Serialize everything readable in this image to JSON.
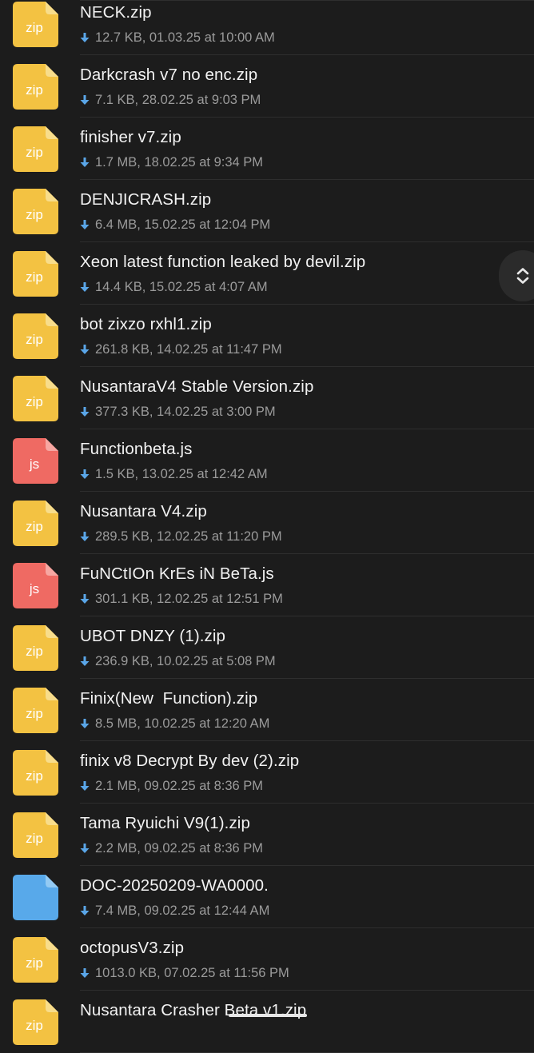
{
  "colors": {
    "background": "#1c1c1c",
    "zip_icon": "#f3c242",
    "zip_fold": "#f8dd8b",
    "js_icon": "#ef6a63",
    "js_fold": "#f7a7a2",
    "doc_icon": "#58a9ea",
    "doc_fold": "#93caf3",
    "name_text": "#f2f2f2",
    "meta_text": "#9b9b9b",
    "download_arrow": "#5aa6e8"
  },
  "files": [
    {
      "name": "NECK.zip",
      "meta": "12.7 KB, 01.03.25 at 10:00 AM",
      "type": "zip",
      "icon_label": "zip"
    },
    {
      "name": "Darkcrash v7 no enc.zip",
      "meta": "7.1 KB, 28.02.25 at 9:03 PM",
      "type": "zip",
      "icon_label": "zip"
    },
    {
      "name": "finisher v7.zip",
      "meta": "1.7 MB, 18.02.25 at 9:34 PM",
      "type": "zip",
      "icon_label": "zip"
    },
    {
      "name": "DENJICRASH.zip",
      "meta": "6.4 MB, 15.02.25 at 12:04 PM",
      "type": "zip",
      "icon_label": "zip"
    },
    {
      "name": "Xeon latest function leaked by devil.zip",
      "meta": "14.4 KB, 15.02.25 at 4:07 AM",
      "type": "zip",
      "icon_label": "zip"
    },
    {
      "name": "bot zixzo rxhl1.zip",
      "meta": "261.8 KB, 14.02.25 at 11:47 PM",
      "type": "zip",
      "icon_label": "zip"
    },
    {
      "name": "NusantaraV4 Stable Version.zip",
      "meta": "377.3 KB, 14.02.25 at 3:00 PM",
      "type": "zip",
      "icon_label": "zip"
    },
    {
      "name": "Functionbeta.js",
      "meta": "1.5 KB, 13.02.25 at 12:42 AM",
      "type": "js",
      "icon_label": "js"
    },
    {
      "name": "Nusantara V4.zip",
      "meta": "289.5 KB, 12.02.25 at 11:20 PM",
      "type": "zip",
      "icon_label": "zip"
    },
    {
      "name": "FuNCtIOn KrEs iN BeTa.js",
      "meta": "301.1 KB, 12.02.25 at 12:51 PM",
      "type": "js",
      "icon_label": "js"
    },
    {
      "name": "UBOT DNZY (1).zip",
      "meta": "236.9 KB, 10.02.25 at 5:08 PM",
      "type": "zip",
      "icon_label": "zip"
    },
    {
      "name": "Finix(New  Function).zip",
      "meta": "8.5 MB, 10.02.25 at 12:20 AM",
      "type": "zip",
      "icon_label": "zip"
    },
    {
      "name": "finix v8 Decrypt By dev (2).zip",
      "meta": "2.1 MB, 09.02.25 at 8:36 PM",
      "type": "zip",
      "icon_label": "zip"
    },
    {
      "name": "Tama Ryuichi V9(1).zip",
      "meta": "2.2 MB, 09.02.25 at 8:36 PM",
      "type": "zip",
      "icon_label": "zip"
    },
    {
      "name": "DOC-20250209-WA0000.",
      "meta": "7.4 MB, 09.02.25 at 12:44 AM",
      "type": "doc",
      "icon_label": ""
    },
    {
      "name": "octopusV3.zip",
      "meta": "1013.0 KB, 07.02.25 at 11:56 PM",
      "type": "zip",
      "icon_label": "zip"
    },
    {
      "name": "Nusantara Crasher Beta v1.zip",
      "meta": "",
      "type": "zip",
      "icon_label": "zip"
    }
  ],
  "fast_scroll_icon": "up-down-chevron-icon",
  "download_icon": "download-arrow-icon"
}
